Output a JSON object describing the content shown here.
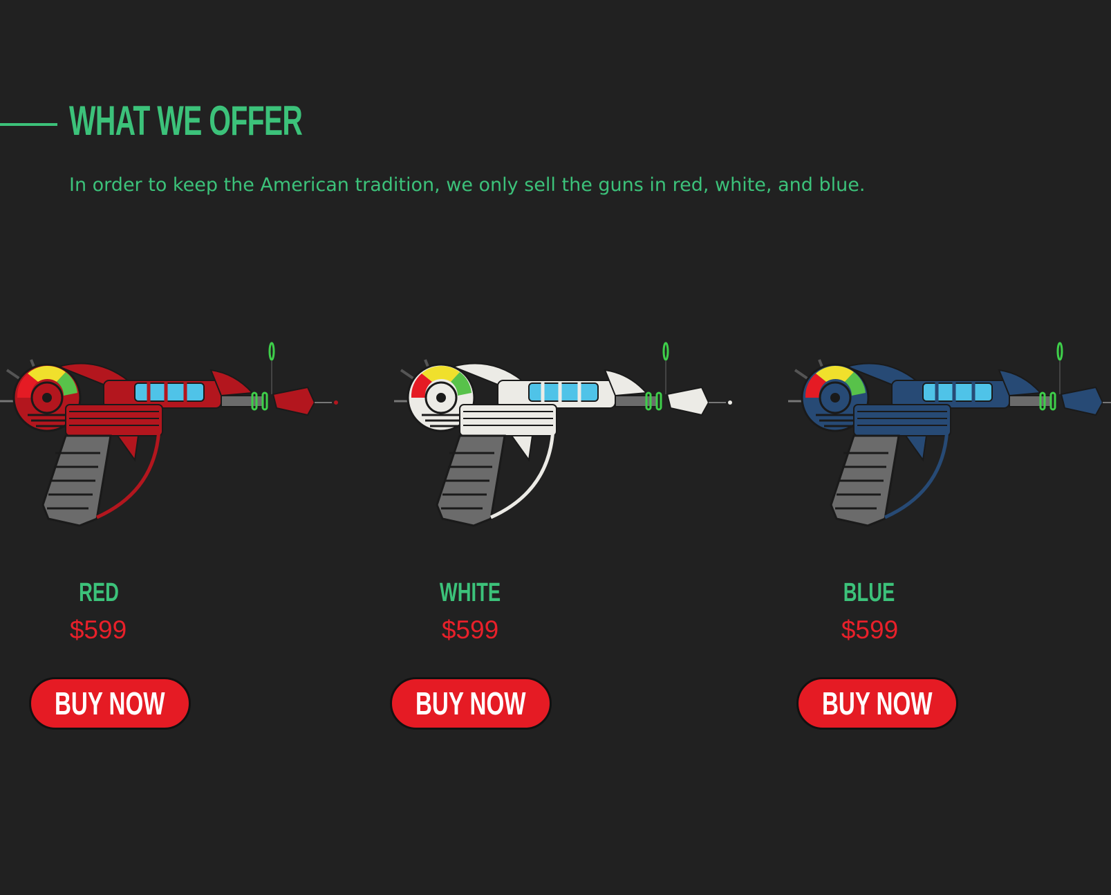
{
  "section": {
    "heading": "WHAT WE OFFER",
    "subtitle": "In order to keep the American tradition, we only sell the guns in red, white, and blue."
  },
  "colors": {
    "accent": "#3cc27a",
    "price": "#e8202a",
    "button": "#e51b24",
    "background": "#212121"
  },
  "products": [
    {
      "name": "RED",
      "price": "$599",
      "button_label": "BUY NOW",
      "gun_color": "#b3161e",
      "image": "ray-gun-red"
    },
    {
      "name": "WHITE",
      "price": "$599",
      "button_label": "BUY NOW",
      "gun_color": "#ecebe6",
      "image": "ray-gun-white"
    },
    {
      "name": "BLUE",
      "price": "$599",
      "button_label": "BUY NOW",
      "gun_color": "#274a75",
      "image": "ray-gun-blue"
    }
  ]
}
